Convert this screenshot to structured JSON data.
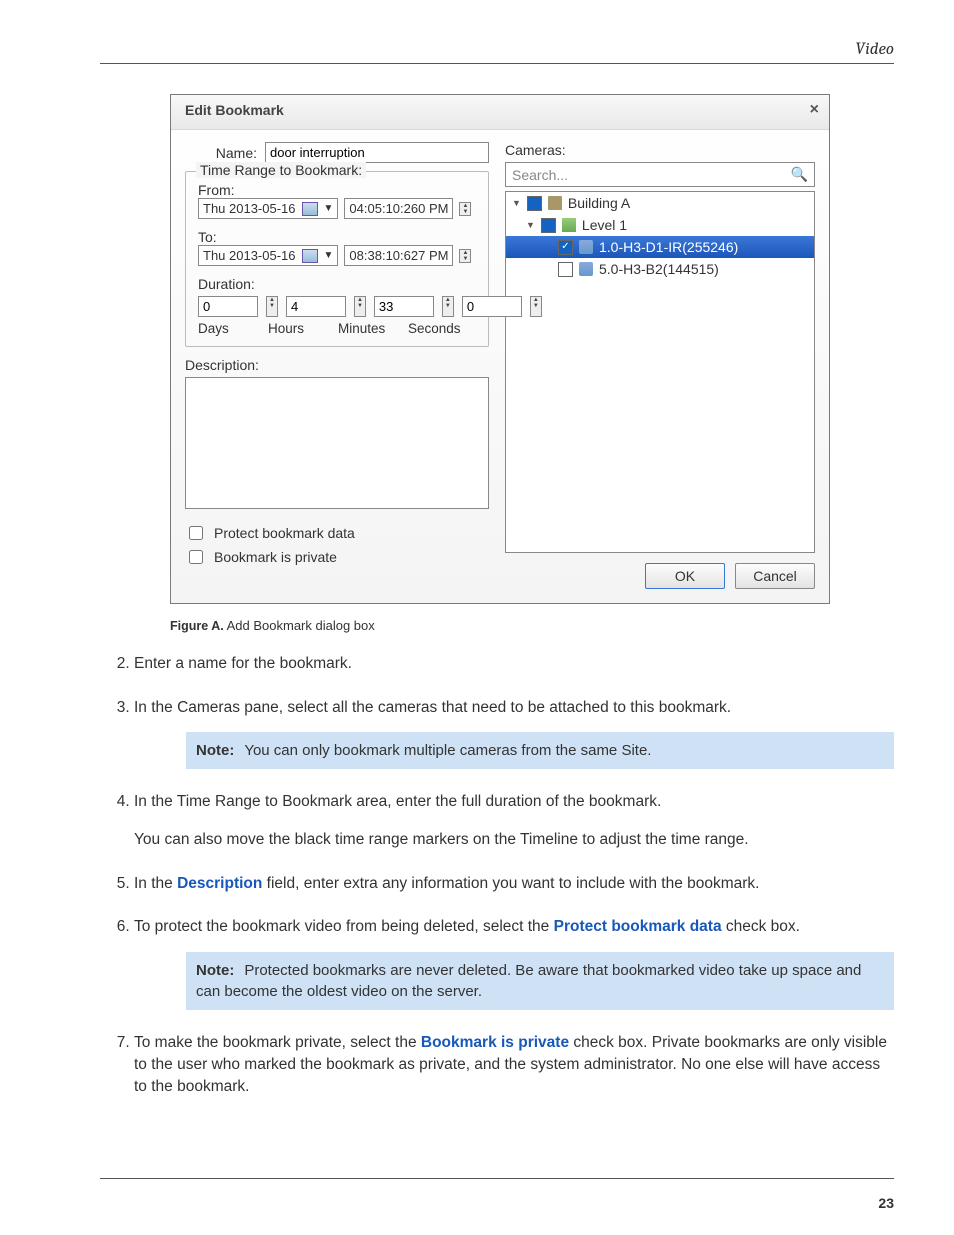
{
  "header": {
    "section": "Video"
  },
  "dialog": {
    "title": "Edit Bookmark",
    "name_label": "Name:",
    "name_value": "door interruption",
    "timerange_legend": "Time Range to Bookmark:",
    "from_label": "From:",
    "from_date": "Thu 2013-05-16",
    "from_time": "04:05:10:260  PM",
    "to_label": "To:",
    "to_date": "Thu 2013-05-16",
    "to_time": "08:38:10:627  PM",
    "duration_label": "Duration:",
    "dur_days": "0",
    "dur_hours": "4",
    "dur_minutes": "33",
    "dur_seconds": "0",
    "days_l": "Days",
    "hours_l": "Hours",
    "minutes_l": "Minutes",
    "seconds_l": "Seconds",
    "description_label": "Description:",
    "chk_protect": "Protect bookmark data",
    "chk_private": "Bookmark is private",
    "cameras_label": "Cameras:",
    "search_placeholder": "Search...",
    "tree": {
      "site": "Building A",
      "server": "Level 1",
      "cam1": "1.0-H3-D1-IR(255246)",
      "cam2": "5.0-H3-B2(144515)"
    },
    "ok": "OK",
    "cancel": "Cancel"
  },
  "caption": {
    "fig": "Figure A.",
    "text": " Add Bookmark dialog box"
  },
  "steps": {
    "s2": "Enter a name for the bookmark.",
    "s3": "In the Cameras pane, select all the cameras that need to be attached to this bookmark.",
    "note1_label": "Note:",
    "note1_text": "You can only bookmark multiple cameras from the same Site.",
    "s4a": "In the Time Range to Bookmark area, enter the full duration of the bookmark.",
    "s4b": "You can also move the black time range markers on the Timeline to adjust the time range.",
    "s5a": "In the ",
    "s5link": "Description",
    "s5b": " field, enter extra any information you want to include with the bookmark.",
    "s6a": "To protect the bookmark video from being deleted, select the ",
    "s6link": "Protect bookmark data",
    "s6b": " check box.",
    "note2_label": "Note:",
    "note2_text": "Protected bookmarks are never deleted. Be aware that bookmarked video take up space and can become the oldest video on the server.",
    "s7a": "To make the bookmark private, select the ",
    "s7link": "Bookmark is private",
    "s7b": " check box. Private bookmarks are only visible to the user who marked the bookmark as private, and the system administrator. No one else will have access to the bookmark."
  },
  "page_number": "23"
}
